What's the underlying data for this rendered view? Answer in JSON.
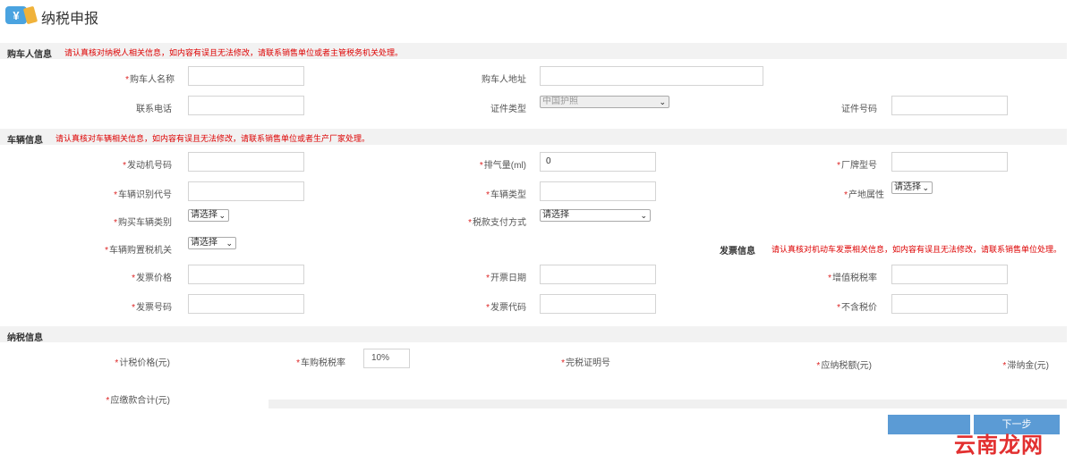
{
  "header": {
    "icon_text": "¥",
    "title": "纳税申报"
  },
  "sections": {
    "buyer": {
      "title": "购车人信息",
      "notice": "请认真核对纳税人相关信息，如内容有误且无法修改，请联系销售单位或者主管税务机关处理。"
    },
    "vehicle": {
      "title": "车辆信息",
      "notice": "请认真核对车辆相关信息，如内容有误且无法修改，请联系销售单位或者生产厂家处理。"
    },
    "invoice": {
      "title": "发票信息",
      "notice": "请认真核对机动车发票相关信息，如内容有误且无法修改，请联系销售单位处理。"
    },
    "tax": {
      "title": "纳税信息"
    }
  },
  "fields": {
    "buyer_name": {
      "label": "购车人名称",
      "required": "*"
    },
    "buyer_address": {
      "label": "购车人地址"
    },
    "contact_phone": {
      "label": "联系电话"
    },
    "id_type": {
      "label": "证件类型",
      "value": "中国护照"
    },
    "id_number": {
      "label": "证件号码"
    },
    "engine_no": {
      "label": "发动机号码",
      "required": "*"
    },
    "displacement": {
      "label": "排气量(ml)",
      "required": "*",
      "value": "0"
    },
    "model_no": {
      "label": "厂牌型号",
      "required": "*"
    },
    "vin": {
      "label": "车辆识别代号",
      "required": "*"
    },
    "vehicle_type": {
      "label": "车辆类型",
      "required": "*"
    },
    "origin": {
      "label": "产地属性",
      "required": "*",
      "value": "请选择"
    },
    "purchase_category": {
      "label": "购买车辆类别",
      "required": "*",
      "value": "请选择"
    },
    "payment_method": {
      "label": "税款支付方式",
      "required": "*",
      "value": "请选择"
    },
    "tax_office": {
      "label": "车辆购置税机关",
      "required": "*",
      "value": "请选择"
    },
    "invoice_price": {
      "label": "发票价格",
      "required": "*"
    },
    "invoice_date": {
      "label": "开票日期",
      "required": "*"
    },
    "vat_rate": {
      "label": "增值税税率",
      "required": "*"
    },
    "invoice_no": {
      "label": "发票号码",
      "required": "*"
    },
    "invoice_code": {
      "label": "发票代码",
      "required": "*"
    },
    "price_excl_tax": {
      "label": "不含税价",
      "required": "*"
    },
    "taxable_price": {
      "label": "计税价格(元)",
      "required": "*"
    },
    "tax_rate": {
      "label": "车购税税率",
      "required": "*",
      "value": "10%"
    },
    "cert_no": {
      "label": "完税证明号",
      "required": "*"
    },
    "tax_payable": {
      "label": "应纳税额(元)",
      "required": "*"
    },
    "late_fee": {
      "label": "滞纳金(元)",
      "required": "*"
    },
    "total_payable": {
      "label": "应缴款合计(元)",
      "required": "*"
    }
  },
  "buttons": {
    "right_label": "下一步"
  },
  "watermark": "云南龙网",
  "colors": {
    "accent_blue": "#5b9bd5",
    "warning_red": "#dd0000",
    "section_bg": "#f2f2f2"
  }
}
